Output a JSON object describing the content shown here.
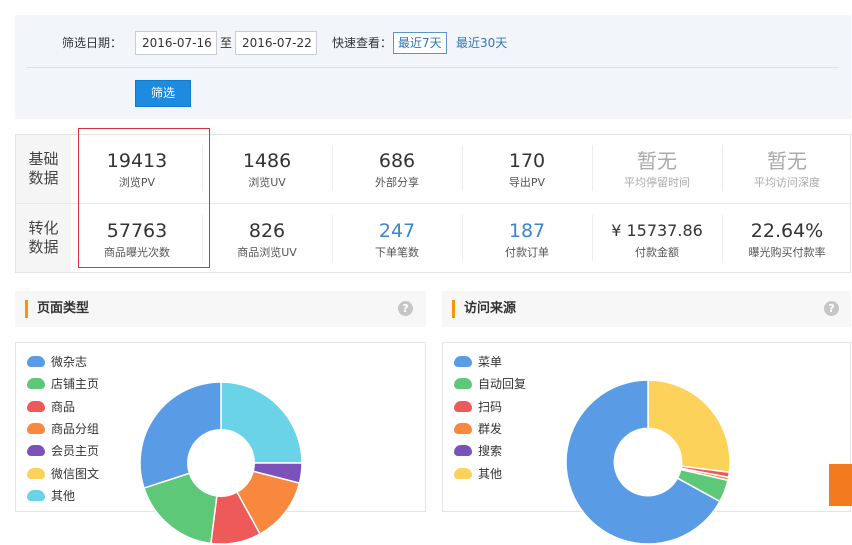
{
  "filter": {
    "date_label": "筛选日期：",
    "start_date": "2016-07-16",
    "to_text": "至",
    "end_date": "2016-07-22",
    "quick_label": "快速查看：",
    "quick_7": "最近7天",
    "quick_30": "最近30天",
    "submit_label": "筛选"
  },
  "stats": {
    "rows": [
      {
        "header": "基础\n数据",
        "cells": [
          {
            "value": "19413",
            "label": "浏览PV"
          },
          {
            "value": "1486",
            "label": "浏览UV"
          },
          {
            "value": "686",
            "label": "外部分享"
          },
          {
            "value": "170",
            "label": "导出PV"
          },
          {
            "value": "暂无",
            "label": "平均停留时间"
          },
          {
            "value": "暂无",
            "label": "平均访问深度"
          }
        ]
      },
      {
        "header": "转化\n数据",
        "cells": [
          {
            "value": "57763",
            "label": "商品曝光次数"
          },
          {
            "value": "826",
            "label": "商品浏览UV"
          },
          {
            "value": "247",
            "label": "下单笔数"
          },
          {
            "value": "187",
            "label": "付款订单"
          },
          {
            "value": "¥ 15737.86",
            "label": "付款金额"
          },
          {
            "value": "22.64%",
            "label": "曝光购买付款率"
          }
        ]
      }
    ]
  },
  "page_type": {
    "title": "页面类型",
    "help": "?",
    "legend": [
      {
        "label": "微杂志",
        "color": "#5a9be6"
      },
      {
        "label": "店铺主页",
        "color": "#5dc878"
      },
      {
        "label": "商品",
        "color": "#ee5a5a"
      },
      {
        "label": "商品分组",
        "color": "#f7883e"
      },
      {
        "label": "会员主页",
        "color": "#7a52b8"
      },
      {
        "label": "微信图文",
        "color": "#fcd25a"
      },
      {
        "label": "其他",
        "color": "#6bd3e8"
      }
    ],
    "slices": [
      {
        "name": "其他",
        "value": 25,
        "color": "#6bd3e8"
      },
      {
        "name": "会员主页",
        "value": 4,
        "color": "#7a52b8"
      },
      {
        "name": "商品分组",
        "value": 13,
        "color": "#f7883e"
      },
      {
        "name": "商品",
        "value": 10,
        "color": "#ee5a5a"
      },
      {
        "name": "店铺主页",
        "value": 18,
        "color": "#5dc878"
      },
      {
        "name": "微杂志",
        "value": 30,
        "color": "#5a9be6"
      }
    ]
  },
  "visit_source": {
    "title": "访问来源",
    "help": "?",
    "legend": [
      {
        "label": "菜单",
        "color": "#5a9be6"
      },
      {
        "label": "自动回复",
        "color": "#5dc878"
      },
      {
        "label": "扫码",
        "color": "#ee5a5a"
      },
      {
        "label": "群发",
        "color": "#f7883e"
      },
      {
        "label": "搜索",
        "color": "#7a52b8"
      },
      {
        "label": "其他",
        "color": "#fcd25a"
      }
    ],
    "slices": [
      {
        "name": "其他",
        "value": 27,
        "color": "#fcd25a"
      },
      {
        "name": "扫码",
        "value": 1,
        "color": "#ee5a5a"
      },
      {
        "name": "群发",
        "value": 0.6,
        "color": "#f7883e"
      },
      {
        "name": "自动回复",
        "value": 4.4,
        "color": "#5dc878"
      },
      {
        "name": "菜单",
        "value": 67,
        "color": "#5a9be6"
      }
    ]
  }
}
